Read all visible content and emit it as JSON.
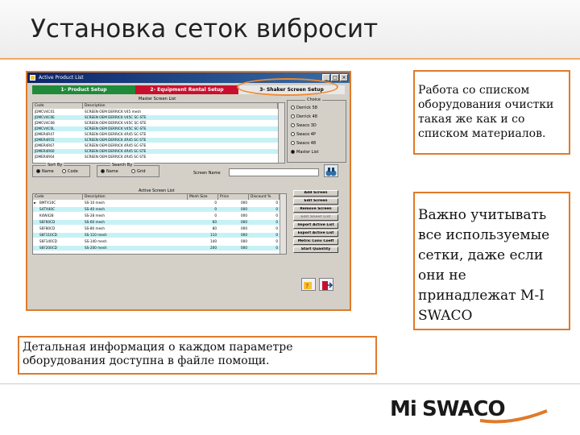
{
  "slide": {
    "title": "Установка сеток вибросит"
  },
  "window": {
    "title": "Active Product List",
    "tabs": [
      "1- Product Setup",
      "2- Equipment Rental Setup",
      "3- Shaker Screen Setup"
    ]
  },
  "master_list": {
    "caption": "Master Screen List",
    "columns": [
      "Code",
      "Description"
    ],
    "rows": [
      [
        "JDMCV4C01",
        "SCREEN OEM DERRICK V45 mesh"
      ],
      [
        "JDMCV4C0E",
        "SCREEN OEM DERRICK V45C SC-STE"
      ],
      [
        "JDMCV4C08",
        "SCREEN OEM DERRICK V45C SC-STE"
      ],
      [
        "JDMCV4C0L",
        "SCREEN OEM DERRICK V45C SC-STE"
      ],
      [
        "JDMER4R47",
        "SCREEN OEM DERRICK 4R45 SC-STE"
      ],
      [
        "JDMER4R55",
        "SCREEN OEM DERRICK 4R45 SC-STE"
      ],
      [
        "JDMER4R67",
        "SCREEN OEM DERRICK 4R45 SC-STE"
      ],
      [
        "JDMER4R60",
        "SCREEN OEM DERRICK 4R45 SC-STE"
      ],
      [
        "JDMER4R64",
        "SCREEN OEM DERRICK 4R45 SC-STE"
      ]
    ]
  },
  "choice": {
    "caption": "Choice",
    "options": [
      "Derrick 58",
      "Derrick 48",
      "Swaco 3D",
      "Swaco 4P",
      "Swaco 48",
      "Master List"
    ],
    "selected": 5
  },
  "sort_by": {
    "caption": "Sort By",
    "options": [
      "Name",
      "Code"
    ],
    "selected": 0
  },
  "search_by": {
    "caption": "Search By",
    "options": [
      "Name",
      "Grid"
    ],
    "selected": 0
  },
  "screen_name": {
    "label": "Screen Name",
    "value": ""
  },
  "active_list": {
    "caption": "Active Screen List",
    "columns": [
      "Code",
      "Description",
      "Mesh Size",
      "Price",
      "Discount %"
    ],
    "rows": [
      [
        "BMTX10C",
        "SS-10 mesh",
        "0",
        "000",
        "0"
      ],
      [
        "S4TX40C",
        "SS-40 mesh",
        "0",
        "000",
        "0"
      ],
      [
        "K4W428",
        "SS-28 mesh",
        "0",
        "000",
        "0"
      ],
      [
        "S6F60CD",
        "SS-60 mesh",
        "60",
        "000",
        "0"
      ],
      [
        "S6F80CD",
        "SS-80 mesh",
        "80",
        "000",
        "0"
      ],
      [
        "S6F110CD",
        "SS-110 mesh",
        "110",
        "000",
        "0"
      ],
      [
        "S6F140CD",
        "SS-140 mesh",
        "140",
        "000",
        "0"
      ],
      [
        "S6F200CD",
        "SS-200 mesh",
        "200",
        "000",
        "0"
      ]
    ]
  },
  "actions": [
    {
      "label": "Add Screen",
      "enabled": true
    },
    {
      "label": "Edit Screen",
      "enabled": true
    },
    {
      "label": "Remove Screen",
      "enabled": true
    },
    {
      "label": "Edit Sheet List",
      "enabled": false
    },
    {
      "label": "Import Active List",
      "enabled": true
    },
    {
      "label": "Export Active List",
      "enabled": true
    },
    {
      "label": "Metric Conv Coeff",
      "enabled": true
    },
    {
      "label": "Start Quantity",
      "enabled": true
    }
  ],
  "callouts": {
    "c1": "Работа со списком оборудования очистки такая же как и со списком материалов.",
    "c2": "Важно учитывать все используемые сетки, даже если они не принадлежат M-I SWACO",
    "c3": "Детальная информация о каждом параметре оборудования доступна в файле помощи."
  },
  "logo": {
    "text": "M-I SWACO",
    "colors": {
      "dark": "#1a1a1a",
      "accent": "#e07a2a"
    }
  }
}
